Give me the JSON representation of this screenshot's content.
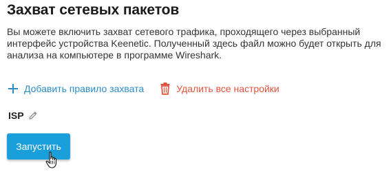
{
  "page": {
    "title": "Захват сетевых пакетов",
    "description": "Вы можете включить захват сетевого трафика, проходящего через выбранный интерфейс устройства Keenetic. Полученный здесь файл можно будет открыть для анализа на компьютере в программе Wireshark."
  },
  "actions": {
    "add_rule_label": "Добавить правило захвата",
    "delete_all_label": "Удалить все настройки",
    "add_icon": "plus-icon",
    "delete_icon": "trash-icon"
  },
  "interface": {
    "name": "ISP",
    "edit_icon": "pencil-icon"
  },
  "start_button": {
    "label": "Запустить"
  },
  "colors": {
    "accent": "#2c8dc7",
    "danger": "#e5533d",
    "button": "#1a9fdb"
  }
}
